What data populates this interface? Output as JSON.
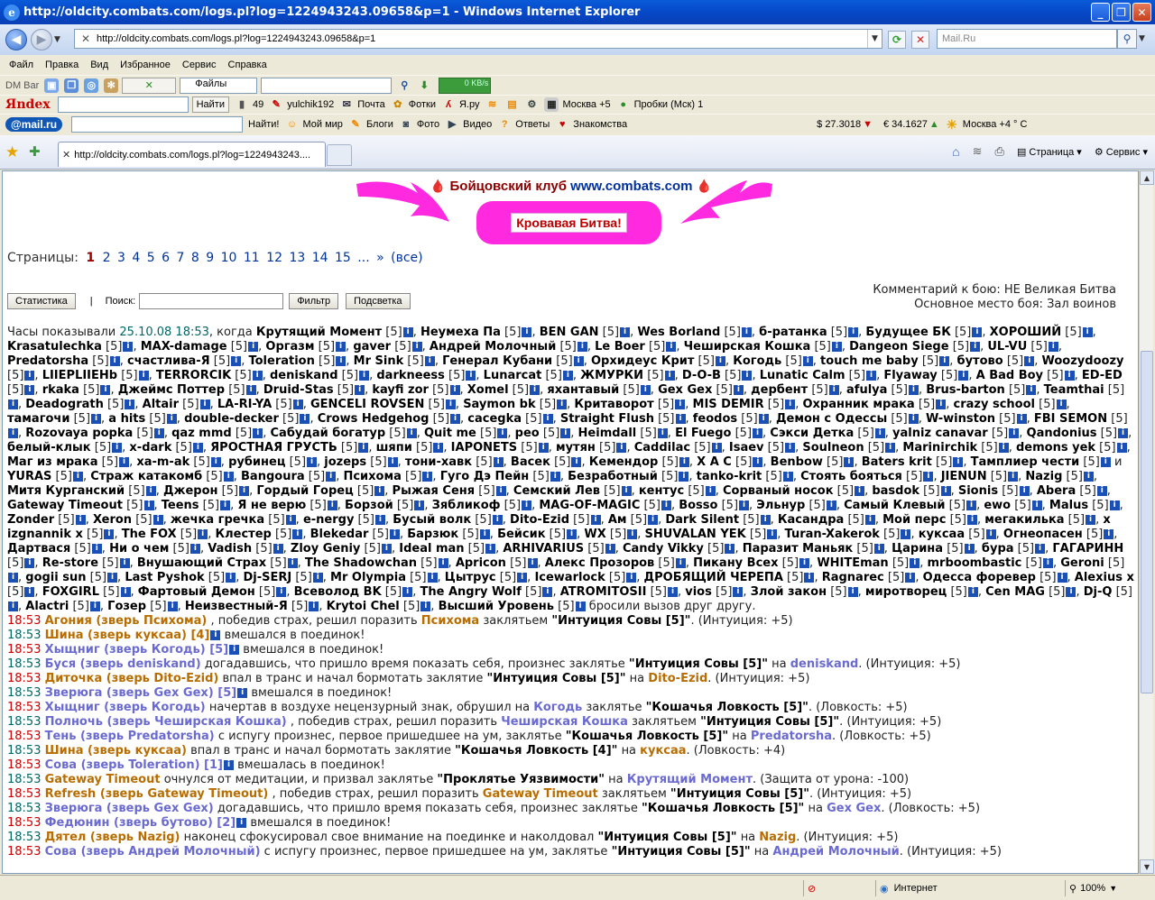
{
  "window": {
    "title": "http://oldcity.combats.com/logs.pl?log=1224943243.09658&p=1 - Windows Internet Explorer"
  },
  "address": {
    "url": "http://oldcity.combats.com/logs.pl?log=1224943243.09658&p=1",
    "search_placeholder": "Mail.Ru"
  },
  "menu": [
    "Файл",
    "Правка",
    "Вид",
    "Избранное",
    "Сервис",
    "Справка"
  ],
  "toolbar1": {
    "label": "DM Bar",
    "files_label": "Файлы",
    "speed": "0 KB/s"
  },
  "toolbar2": {
    "logo": "Яndex",
    "find_button": "Найти",
    "count": "49",
    "user": "yulchik192",
    "mail": "Почта",
    "photos": "Фотки",
    "yaru": "Я.ру",
    "weather": "Москва +5",
    "traffic": "Пробки (Мск) 1"
  },
  "toolbar3": {
    "logo": "@mail.ru",
    "find_button": "Найти!",
    "items": [
      "Мой мир",
      "Блоги",
      "Фото",
      "Видео",
      "Ответы",
      "Знакомства"
    ],
    "usd": "$ 27.3018",
    "eur": "€ 34.1627",
    "weather": "Москва +4 ° C"
  },
  "tab": {
    "title": "http://oldcity.combats.com/logs.pl?log=1224943243...."
  },
  "cmdbar": [
    "Страница",
    "Сервис"
  ],
  "page": {
    "club_prefix": "Бойцовский клуб",
    "club_site": "www.combats.com",
    "battle_badge": "Кровавая Битва!",
    "pages_label": "Страницы:",
    "pages": [
      "1",
      "2",
      "3",
      "4",
      "5",
      "6",
      "7",
      "8",
      "9",
      "10",
      "11",
      "12",
      "13",
      "14",
      "15",
      "...",
      "»"
    ],
    "pages_all": "(все)",
    "stats_button": "Статистика",
    "search_label": "Поиск:",
    "filter_button": "Фильтр",
    "highlight_button": "Подсветка",
    "comment_line": "Комментарий к бою: НЕ Великая Битва",
    "place_line": "Основное место боя: Зал воинов",
    "intro_prefix": "Часы показывали",
    "intro_time": "25.10.08 18:53",
    "intro_when": ", когда",
    "participants": "Крутящий Момент [5]i, Неумеха Па [5]i, BEN GAN [5]i, Wes Borland [5]i, б-ратанка [5]i, Будущее БК [5]i, ХОРОШИЙ [5]i, Krasatulechka [5]i, MAX-damage [5]i, Оргазм [5]i, gaver [5]i, Андрей Молочный [5]i, Le Boer [5]i, Чеширская Кошка [5]i, Dangeon Siege [5]i, UL-VU [5]i, Predatorsha [5]i, счастлива-Я [5]i, Toleration [5]i, Mr Sink [5]i, Генерал Кубани [5]i, Орхидеус Крит [5]i, Когодь [5]i, touch me baby [5]i, бутово [5]i, Woozydoozy [5]i, LIIEPLIIEHb [5]i, TERRORCIK [5]i, deniskand [5]i, darkneess [5]i, Lunarcat [5]i, ЖМУРКИ [5]i, D-O-B [5]i, Lunatic Calm [5]i, Flyaway [5]i, A Bad Boy [5]i, ED-ED [5]i, rkaka [5]i, Джеймс Поттер [5]i, Druid-Stas [5]i, kayfi zor [5]i, Xomel [5]i, яхантавый [5]i, Gex Gex [5]i, дербент [5]i, afulya [5]i, Brus-barton [5]i, Teamthai [5]i, Deadograth [5]i, Altair [5]i, LA-RI-YA [5]i, GENCELI ROVSEN [5]i, Saymon bk [5]i, Критаворот [5]i, MIS DEMIR [5]i, Охранник мрака [5]i, crazy school [5]i, тамагочи [5]i, a hits [5]i, double-decker [5]i, Crows Hedgehog [5]i, cacegka [5]i, Straight Flush [5]i, feodos [5]i, Демон с Одессы [5]i, W-winston [5]i, FBI SEMON [5]i, Rozovaya popka [5]i, qaz mmd [5]i, Сабудай богатур [5]i, Quit me [5]i, peo [5]i, Heimdall [5]i, El Fuego [5]i, Сэкси Детка [5]i, yalniz canavar [5]i, Qandonius [5]i, белый-клык [5]i, x-dark [5]i, ЯРОСТНАЯ ГРУСТЬ [5]i, шяпи [5]i, IAPONETS [5]i, мутян [5]i, Caddilac [5]i, Isaev [5]i, Soulneon [5]i, Marinirchik [5]i, demons yek [5]i, Маг из мрака [5]i, ха-m-ak [5]i, рубинец [5]i, jozeps [5]i, тони-хавк [5]i, Васек [5]i, Кемендор [5]i, X A C [5]i, Benbow [5]i, Baters krit [5]i, Тамплиер чести [5]i и YURAS [5]i, Страж катакомб [5]i, Bangoura [5]i, Психома [5]i, Гуго Дэ Пейн [5]i, Безработный [5]i, tanko-krit [5]i, Стоять бояться [5]i, JIENUN [5]i, Nazig [5]i, Митя Курганский [5]i, Джерон [5]i, Гордый Горец [5]i, Рыжая Сеня [5]i, Семский Лев [5]i, кентус [5]i, Сорваный носок [5]i, basdok [5]i, Sionis [5]i, Abera [5]i, Gateway Timeout [5]i, Teens [5]i, Я не верю [5]i, Борзой [5]i, Зябликоф [5]i, MAG-OF-MAGIC [5]i, Bosso [5]i, Эльнур [5]i, Самый Клевый [5]i, ewo [5]i, Malus [5]i, Zonder [5]i, Xeron [5]i, жечка гречка [5]i, e-nergy [5]i, Бусый волк [5]i, Dito-Ezid [5]i, Ам [5]i, Dark Silent [5]i, Касандра [5]i, Мой перс [5]i, мегакилька [5]i, x izgnannik x [5]i, The FOX [5]i, Клестер [5]i, Blekedar [5]i, Барзюк [5]i, Бейсик [5]i, WX [5]i, SHUVALAN YEK [5]i, Turan-Xakerok [5]i, куксаа [5]i, Огнеопасен [5]i, Дартвася [5]i, Ни о чем [5]i, Vadish [5]i, Zloy Geniy [5]i, Ideal man [5]i, ARHIVARIUS [5]i, Candy Vikky [5]i, Паразит Маньяк [5]i, Царина [5]i, бура [5]i, ГАГАРИНН [5]i, Re-store [5]i, Внушающий Страх [5]i, The Shadowchan [5]i, Apricon [5]i, Алекс Прозоров [5]i, Пикану Всех [5]i, WHITEman [5]i, mrboombastic [5]i, Geroni [5]i, gogii sun [5]i, Last Pyshok [5]i, Dj-SERJ [5]i, Mr Olympia [5]i, Цытрус [5]i, Icewarlock [5]i, ДРОБЯЩИЙ ЧЕРЕПА [5]i, Ragnarec [5]i, Одесса форевер [5]i, Alexius x [5]i, FOXGIRL [5]i, Фартовый Демон [5]i, Всеволод BK [5]i, The Angry Wolf [5]i, ATROMITOSII [5]i, vios [5]i, Злой закон [5]i, миротворец [5]i, Cen MAG [5]i, Dj-Q [5]i, Alactri [5]i, Гозер [5]i, Неизвестный-Я [5]i, Krytoi Chel [5]i, Высший Уровень [5]i",
    "intro_end": "бросили вызов друг другу.",
    "events": [
      {
        "time": "18:53",
        "a": "Агония (зверь Психома)",
        "ac": "or",
        "mid": ", победив страх, решил поразить",
        "b": "Психома",
        "bc": "or",
        "pre": "заклятьем",
        "spell": "\"Интуиция Совы [5]\"",
        "tail": ". (Интуиция: +5)"
      },
      {
        "time": "18:53",
        "a": "Шина (зверь куксаа) [4]",
        "ac": "or",
        "inf": true,
        "mid": "вмешался в поединок!",
        "b": "",
        "bc": "",
        "pre": "",
        "spell": "",
        "tail": ""
      },
      {
        "time": "18:53",
        "a": "Хыщниг (зверь Когодь) [5]",
        "ac": "bl",
        "inf": true,
        "mid": "вмешался в поединок!",
        "b": "",
        "bc": "",
        "pre": "",
        "spell": "",
        "tail": ""
      },
      {
        "time": "18:53",
        "a": "Буся (зверь deniskand)",
        "ac": "bl",
        "mid": "догадавшись, что пришло время показать себя, произнес заклятье",
        "b": "",
        "bc": "",
        "pre": "",
        "spell": "\"Интуиция Совы [5]\"",
        "on": "на",
        "c": "deniskand",
        "cc": "bl",
        "tail": ". (Интуиция: +5)"
      },
      {
        "time": "18:53",
        "a": "Диточка (зверь Dito-Ezid)",
        "ac": "or",
        "mid": "впал в транс и начал бормотать заклятие",
        "b": "",
        "bc": "",
        "pre": "",
        "spell": "\"Интуиция Совы [5]\"",
        "on": "на",
        "c": "Dito-Ezid",
        "cc": "or",
        "tail": ". (Интуиция: +5)"
      },
      {
        "time": "18:53",
        "a": "Зверюга (зверь Gex Gex) [5]",
        "ac": "bl",
        "inf": true,
        "mid": "вмешался в поединок!",
        "b": "",
        "bc": "",
        "pre": "",
        "spell": "",
        "tail": ""
      },
      {
        "time": "18:53",
        "a": "Хыщниг (зверь Когодь)",
        "ac": "bl",
        "mid": "начертав в воздухе нецензурный знак, обрушил на",
        "b": "Когодь",
        "bc": "bl",
        "pre": "заклятье",
        "spell": "\"Кошачья Ловкость [5]\"",
        "tail": ". (Ловкость: +5)"
      },
      {
        "time": "18:53",
        "a": "Полночь (зверь Чеширская Кошка)",
        "ac": "bl",
        "mid": ", победив страх, решил поразить",
        "b": "Чеширская Кошка",
        "bc": "bl",
        "pre": "заклятьем",
        "spell": "\"Интуиция Совы [5]\"",
        "tail": ". (Интуиция: +5)"
      },
      {
        "time": "18:53",
        "a": "Тень (зверь Predatorsha)",
        "ac": "bl",
        "mid": "с испугу произнес, первое пришедшее на ум, заклятье",
        "b": "",
        "bc": "",
        "pre": "",
        "spell": "\"Кошачья Ловкость [5]\"",
        "on": "на",
        "c": "Predatorsha",
        "cc": "bl",
        "tail": ". (Ловкость: +5)"
      },
      {
        "time": "18:53",
        "a": "Шина (зверь куксаа)",
        "ac": "or",
        "mid": "впал в транс и начал бормотать заклятие",
        "b": "",
        "bc": "",
        "pre": "",
        "spell": "\"Кошачья Ловкость [4]\"",
        "on": "на",
        "c": "куксаа",
        "cc": "or",
        "tail": ". (Ловкость: +4)"
      },
      {
        "time": "18:53",
        "a": "Сова (зверь Toleration) [1]",
        "ac": "bl",
        "inf": true,
        "mid": "вмешалась в поединок!",
        "b": "",
        "bc": "",
        "pre": "",
        "spell": "",
        "tail": ""
      },
      {
        "time": "18:53",
        "a": "Gateway Timeout",
        "ac": "or",
        "mid": "очнулся от медитации, и призвал заклятье",
        "b": "",
        "bc": "",
        "pre": "",
        "spell": "\"Проклятье Уязвимости\"",
        "on": "на",
        "c": "Крутящий Момент",
        "cc": "bl",
        "tail": ". (Защита от урона: -100)"
      },
      {
        "time": "18:53",
        "a": "Refresh (зверь Gateway Timeout)",
        "ac": "or",
        "mid": ", победив страх, решил поразить",
        "b": "Gateway Timeout",
        "bc": "or",
        "pre": "заклятьем",
        "spell": "\"Интуиция Совы [5]\"",
        "tail": ". (Интуиция: +5)"
      },
      {
        "time": "18:53",
        "a": "Зверюга (зверь Gex Gex)",
        "ac": "bl",
        "mid": "догадавшись, что пришло время показать себя, произнес заклятье",
        "b": "",
        "bc": "",
        "pre": "",
        "spell": "\"Кошачья Ловкость [5]\"",
        "on": "на",
        "c": "Gex Gex",
        "cc": "bl",
        "tail": ". (Ловкость: +5)"
      },
      {
        "time": "18:53",
        "a": "Федюнин (зверь бутово) [2]",
        "ac": "bl",
        "inf": true,
        "mid": "вмешался в поединок!",
        "b": "",
        "bc": "",
        "pre": "",
        "spell": "",
        "tail": ""
      },
      {
        "time": "18:53",
        "a": "Дятел (зверь Nazig)",
        "ac": "or",
        "mid": "наконец сфокусировал свое внимание на поединке и наколдовал",
        "b": "",
        "bc": "",
        "pre": "",
        "spell": "\"Интуиция Совы [5]\"",
        "on": "на",
        "c": "Nazig",
        "cc": "or",
        "tail": ". (Интуиция: +5)"
      },
      {
        "time": "18:53",
        "a": "Сова (зверь Андрей Молочный)",
        "ac": "bl",
        "mid": "с испугу произнес, первое пришедшее на ум, заклятье",
        "b": "",
        "bc": "",
        "pre": "",
        "spell": "\"Интуиция Совы [5]\"",
        "on": "на",
        "c": "Андрей Молочный",
        "cc": "bl",
        "tail": ". (Интуиция: +5)"
      }
    ]
  },
  "status": {
    "zone": "Интернет",
    "zoom": "100%"
  }
}
